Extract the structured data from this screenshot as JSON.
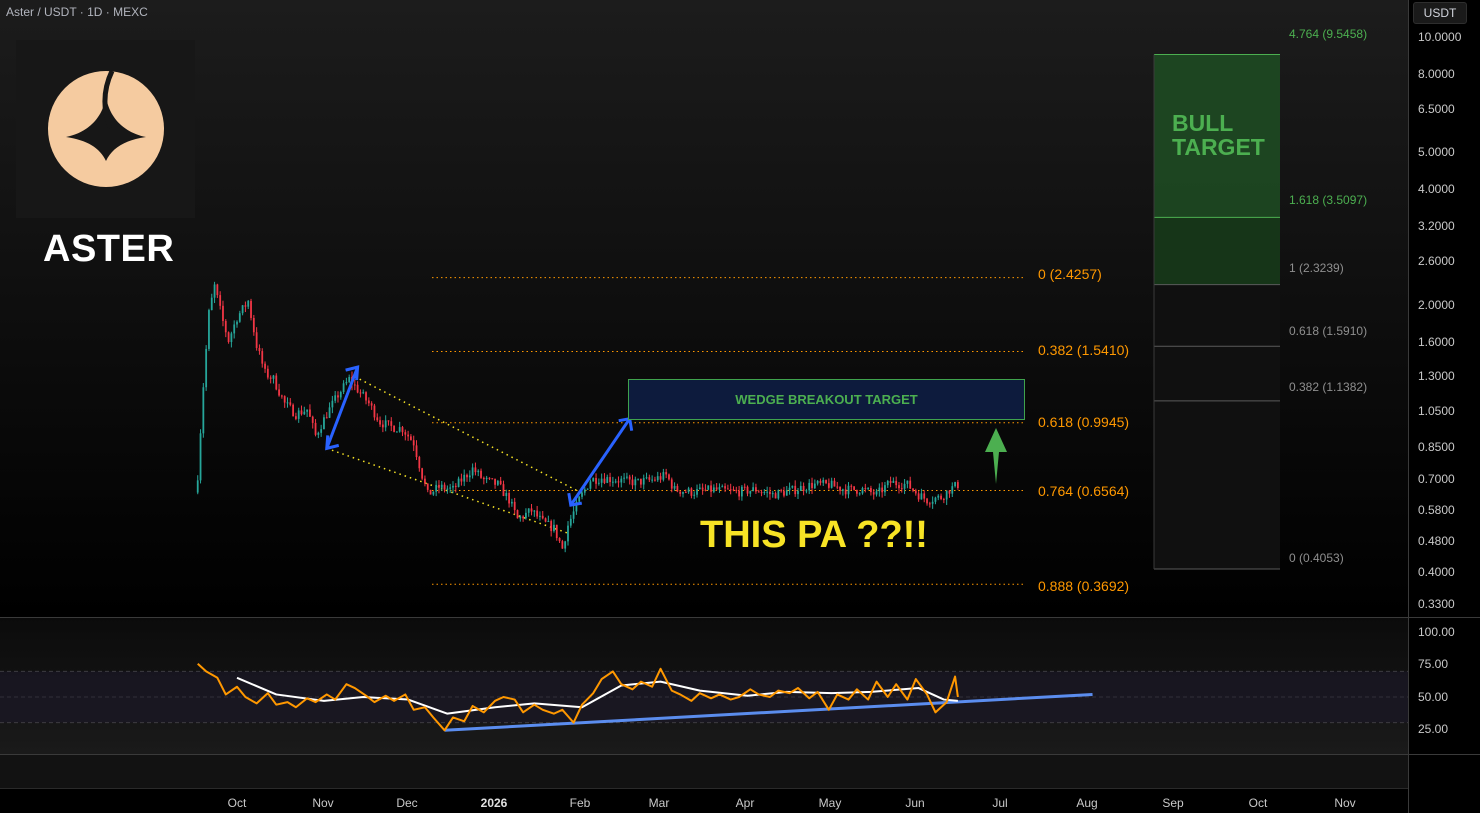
{
  "header": {
    "symbol_title": "Aster / USDT · 1D · MEXC",
    "currency": "USDT"
  },
  "brand": {
    "name": "ASTER",
    "logo_color": "#f5cba0"
  },
  "annotations": {
    "wedge_target": "WEDGE BREAKOUT TARGET",
    "bull_target_line1": "BULL",
    "bull_target_line2": "TARGET",
    "pa_text": "THIS PA ??!!"
  },
  "colors": {
    "up": "#26a69a",
    "down": "#f23645",
    "fib": "#ff9800",
    "wedge": "#f7e325",
    "arrow": "#2962ff",
    "rsi": "#ff9800",
    "rsi_ma": "#ffffff",
    "trendline": "#5b8def",
    "target": "#4caf50"
  },
  "chart_data": [
    {
      "type": "candlestick",
      "title": "Aster / USDT · 1D · MEXC",
      "y_scale": "log",
      "ylim": [
        0.3,
        11
      ],
      "y_ticks": [
        "10.0000",
        "8.0000",
        "6.5000",
        "5.0000",
        "4.0000",
        "3.2000",
        "2.6000",
        "2.0000",
        "1.6000",
        "1.3000",
        "1.0500",
        "0.8500",
        "0.7000",
        "0.5800",
        "0.4800",
        "0.4000",
        "0.3300"
      ],
      "x_ticks": [
        "Oct",
        "Nov",
        "Dec",
        "2026",
        "Feb",
        "Mar",
        "Apr",
        "May",
        "Jun",
        "Jul",
        "Aug",
        "Sep",
        "Oct",
        "Nov"
      ],
      "price_path": [
        [
          "2025-09-17",
          0.72
        ],
        [
          "2025-09-19",
          1.25
        ],
        [
          "2025-09-21",
          1.95
        ],
        [
          "2025-09-23",
          2.3
        ],
        [
          "2025-09-26",
          1.85
        ],
        [
          "2025-09-28",
          1.65
        ],
        [
          "2025-10-01",
          1.9
        ],
        [
          "2025-10-05",
          2.1
        ],
        [
          "2025-10-08",
          1.6
        ],
        [
          "2025-10-11",
          1.35
        ],
        [
          "2025-10-14",
          1.3
        ],
        [
          "2025-10-18",
          1.12
        ],
        [
          "2025-10-22",
          1.05
        ],
        [
          "2025-10-26",
          1.08
        ],
        [
          "2025-10-29",
          0.92
        ],
        [
          "2025-11-02",
          1.05
        ],
        [
          "2025-11-06",
          1.18
        ],
        [
          "2025-11-10",
          1.3
        ],
        [
          "2025-11-13",
          1.22
        ],
        [
          "2025-11-17",
          1.12
        ],
        [
          "2025-11-21",
          1.0
        ],
        [
          "2025-11-25",
          0.97
        ],
        [
          "2025-11-29",
          0.96
        ],
        [
          "2025-12-03",
          0.88
        ],
        [
          "2025-12-06",
          0.72
        ],
        [
          "2025-12-08",
          0.64
        ],
        [
          "2025-12-12",
          0.67
        ],
        [
          "2025-12-17",
          0.66
        ],
        [
          "2025-12-20",
          0.7
        ],
        [
          "2025-12-24",
          0.75
        ],
        [
          "2025-12-28",
          0.7
        ],
        [
          "2026-01-02",
          0.68
        ],
        [
          "2026-01-06",
          0.62
        ],
        [
          "2026-01-09",
          0.55
        ],
        [
          "2026-01-14",
          0.58
        ],
        [
          "2026-01-18",
          0.54
        ],
        [
          "2026-01-22",
          0.52
        ],
        [
          "2026-01-25",
          0.46
        ],
        [
          "2026-01-27",
          0.53
        ],
        [
          "2026-01-31",
          0.62
        ],
        [
          "2026-02-04",
          0.7
        ],
        [
          "2026-02-08",
          0.71
        ],
        [
          "2026-02-14",
          0.7
        ],
        [
          "2026-02-20",
          0.69
        ],
        [
          "2026-02-26",
          0.7
        ],
        [
          "2026-03-03",
          0.72
        ],
        [
          "2026-03-06",
          0.66
        ],
        [
          "2026-03-12",
          0.65
        ],
        [
          "2026-03-20",
          0.66
        ],
        [
          "2026-03-28",
          0.65
        ],
        [
          "2026-04-04",
          0.66
        ],
        [
          "2026-04-10",
          0.64
        ],
        [
          "2026-04-18",
          0.66
        ],
        [
          "2026-04-24",
          0.68
        ],
        [
          "2026-04-30",
          0.68
        ],
        [
          "2026-05-06",
          0.66
        ],
        [
          "2026-05-12",
          0.66
        ],
        [
          "2026-05-17",
          0.64
        ],
        [
          "2026-05-22",
          0.69
        ],
        [
          "2026-05-28",
          0.68
        ],
        [
          "2026-06-01",
          0.64
        ],
        [
          "2026-06-04",
          0.62
        ],
        [
          "2026-06-09",
          0.63
        ],
        [
          "2026-06-12",
          0.66
        ],
        [
          "2026-06-15",
          0.68
        ]
      ],
      "fib_retracement": [
        {
          "level": "0",
          "price": 2.4257,
          "label": "0 (2.4257)"
        },
        {
          "level": "0.382",
          "price": 1.541,
          "label": "0.382 (1.5410)"
        },
        {
          "level": "0.618",
          "price": 0.9945,
          "label": "0.618 (0.9945)"
        },
        {
          "level": "0.764",
          "price": 0.6564,
          "label": "0.764 (0.6564)"
        },
        {
          "level": "0.888",
          "price": 0.3692,
          "label": "0.888 (0.3692)"
        }
      ],
      "fib_extension": [
        {
          "level": "4.764",
          "price": 9.5458,
          "label": "4.764 (9.5458)",
          "highlight": true
        },
        {
          "level": "1.618",
          "price": 3.5097,
          "label": "1.618 (3.5097)",
          "highlight": true
        },
        {
          "level": "1",
          "price": 2.3239,
          "label": "1 (2.3239)",
          "highlight": false
        },
        {
          "level": "0.618",
          "price": 1.591,
          "label": "0.618 (1.5910)",
          "highlight": false
        },
        {
          "level": "0.382",
          "price": 1.1382,
          "label": "0.382 (1.1382)",
          "highlight": false
        },
        {
          "level": "0",
          "price": 0.4053,
          "label": "0 (0.4053)",
          "highlight": false
        }
      ],
      "wedge_target_range": [
        0.99,
        1.27
      ],
      "bull_target_range": [
        3.5097,
        9.5458
      ]
    },
    {
      "type": "line",
      "title": "",
      "ylim": [
        0,
        100
      ],
      "y_ticks": [
        "100.00",
        "75.00",
        "50.00",
        "25.00"
      ],
      "bands": [
        30,
        50,
        70
      ],
      "rsi": [
        [
          "2025-09-17",
          76
        ],
        [
          "2025-09-20",
          70
        ],
        [
          "2025-09-24",
          65
        ],
        [
          "2025-09-27",
          52
        ],
        [
          "2025-10-01",
          58
        ],
        [
          "2025-10-04",
          50
        ],
        [
          "2025-10-08",
          45
        ],
        [
          "2025-10-12",
          53
        ],
        [
          "2025-10-15",
          44
        ],
        [
          "2025-10-19",
          46
        ],
        [
          "2025-10-22",
          42
        ],
        [
          "2025-10-26",
          49
        ],
        [
          "2025-10-29",
          46
        ],
        [
          "2025-11-02",
          52
        ],
        [
          "2025-11-05",
          48
        ],
        [
          "2025-11-09",
          60
        ],
        [
          "2025-11-12",
          57
        ],
        [
          "2025-11-16",
          51
        ],
        [
          "2025-11-19",
          46
        ],
        [
          "2025-11-23",
          51
        ],
        [
          "2025-11-26",
          47
        ],
        [
          "2025-11-30",
          52
        ],
        [
          "2025-12-03",
          40
        ],
        [
          "2025-12-07",
          42
        ],
        [
          "2025-12-10",
          34
        ],
        [
          "2025-12-14",
          24
        ],
        [
          "2025-12-17",
          34
        ],
        [
          "2025-12-21",
          31
        ],
        [
          "2025-12-24",
          43
        ],
        [
          "2025-12-28",
          38
        ],
        [
          "2026-01-01",
          47
        ],
        [
          "2026-01-04",
          50
        ],
        [
          "2026-01-08",
          48
        ],
        [
          "2026-01-11",
          38
        ],
        [
          "2026-01-15",
          44
        ],
        [
          "2026-01-18",
          40
        ],
        [
          "2026-01-22",
          37
        ],
        [
          "2026-01-25",
          40
        ],
        [
          "2026-01-29",
          30
        ],
        [
          "2026-02-01",
          44
        ],
        [
          "2026-02-05",
          53
        ],
        [
          "2026-02-08",
          64
        ],
        [
          "2026-02-12",
          70
        ],
        [
          "2026-02-15",
          60
        ],
        [
          "2026-02-19",
          56
        ],
        [
          "2026-02-22",
          62
        ],
        [
          "2026-02-26",
          58
        ],
        [
          "2026-03-01",
          72
        ],
        [
          "2026-03-05",
          55
        ],
        [
          "2026-03-08",
          52
        ],
        [
          "2026-03-12",
          47
        ],
        [
          "2026-03-15",
          53
        ],
        [
          "2026-03-19",
          49
        ],
        [
          "2026-03-22",
          52
        ],
        [
          "2026-03-26",
          48
        ],
        [
          "2026-03-29",
          50
        ],
        [
          "2026-04-02",
          56
        ],
        [
          "2026-04-05",
          52
        ],
        [
          "2026-04-09",
          50
        ],
        [
          "2026-04-12",
          55
        ],
        [
          "2026-04-16",
          53
        ],
        [
          "2026-04-19",
          57
        ],
        [
          "2026-04-23",
          49
        ],
        [
          "2026-04-26",
          54
        ],
        [
          "2026-04-30",
          40
        ],
        [
          "2026-05-03",
          52
        ],
        [
          "2026-05-07",
          48
        ],
        [
          "2026-05-10",
          56
        ],
        [
          "2026-05-14",
          48
        ],
        [
          "2026-05-17",
          62
        ],
        [
          "2026-05-21",
          50
        ],
        [
          "2026-05-24",
          60
        ],
        [
          "2026-05-28",
          48
        ],
        [
          "2026-05-31",
          64
        ],
        [
          "2026-06-04",
          52
        ],
        [
          "2026-06-07",
          38
        ],
        [
          "2026-06-11",
          46
        ],
        [
          "2026-06-14",
          66
        ],
        [
          "2026-06-15",
          50
        ]
      ],
      "rsi_ma": [
        [
          "2025-10-01",
          65
        ],
        [
          "2025-10-15",
          52
        ],
        [
          "2025-11-01",
          47
        ],
        [
          "2025-11-15",
          50
        ],
        [
          "2025-12-01",
          48
        ],
        [
          "2025-12-15",
          37
        ],
        [
          "2026-01-01",
          42
        ],
        [
          "2026-01-15",
          45
        ],
        [
          "2026-02-01",
          42
        ],
        [
          "2026-02-15",
          59
        ],
        [
          "2026-03-01",
          62
        ],
        [
          "2026-03-15",
          55
        ],
        [
          "2026-04-01",
          51
        ],
        [
          "2026-04-15",
          54
        ],
        [
          "2026-05-01",
          53
        ],
        [
          "2026-05-15",
          54
        ],
        [
          "2026-06-01",
          57
        ],
        [
          "2026-06-10",
          48
        ],
        [
          "2026-06-15",
          47
        ]
      ],
      "trendline": [
        [
          "2025-12-14",
          24
        ],
        [
          "2026-08-02",
          52
        ]
      ]
    }
  ]
}
